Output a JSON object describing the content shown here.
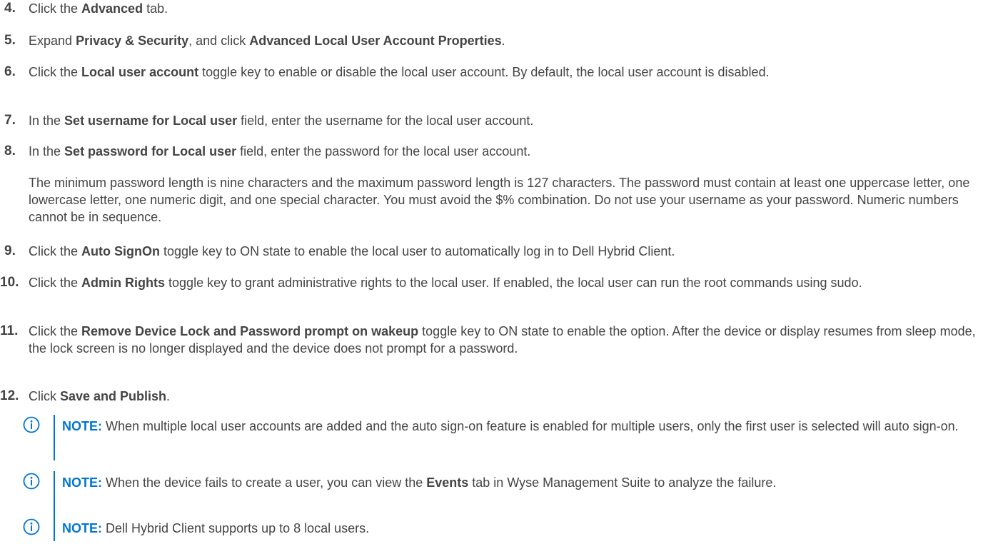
{
  "steps": [
    {
      "num": "4.",
      "parts": [
        {
          "t": "Click the "
        },
        {
          "b": "Advanced"
        },
        {
          "t": " tab."
        }
      ]
    },
    {
      "num": "5.",
      "parts": [
        {
          "t": "Expand "
        },
        {
          "b": "Privacy & Security"
        },
        {
          "t": ", and click "
        },
        {
          "b": "Advanced Local User Account Properties"
        },
        {
          "t": "."
        }
      ]
    },
    {
      "num": "6.",
      "parts": [
        {
          "t": "Click the "
        },
        {
          "b": "Local user account"
        },
        {
          "t": " toggle key to enable or disable the local user account. By default, the local user account is disabled."
        }
      ]
    },
    {
      "num": "7.",
      "parts": [
        {
          "t": "In the "
        },
        {
          "b": "Set username for Local user"
        },
        {
          "t": " field, enter the username for the local user account."
        }
      ]
    },
    {
      "num": "8.",
      "parts": [
        {
          "t": "In the "
        },
        {
          "b": "Set password for Local user"
        },
        {
          "t": " field, enter the password for the local user account."
        }
      ]
    },
    {
      "num": "9.",
      "parts": [
        {
          "t": "Click the "
        },
        {
          "b": "Auto SignOn"
        },
        {
          "t": " toggle key to ON state to enable the local user to automatically log in to Dell Hybrid Client."
        }
      ]
    },
    {
      "num": "10.",
      "parts": [
        {
          "t": "Click the "
        },
        {
          "b": "Admin Rights"
        },
        {
          "t": " toggle key to grant administrative rights to the local user. If enabled, the local user can run the root commands using sudo."
        }
      ]
    },
    {
      "num": "11.",
      "parts": [
        {
          "t": "Click the "
        },
        {
          "b": "Remove Device Lock and Password prompt on wakeup"
        },
        {
          "t": " toggle key to ON state to enable the option. After the device or display resumes from sleep mode, the lock screen is no longer displayed and the device does not prompt for a password."
        }
      ]
    },
    {
      "num": "12.",
      "parts": [
        {
          "t": "Click "
        },
        {
          "b": "Save and Publish"
        },
        {
          "t": "."
        }
      ]
    }
  ],
  "password_paragraph": "The minimum password length is nine characters and the maximum password length is 127 characters. The password must contain at least one uppercase letter, one lowercase letter, one numeric digit, and one special character. You must avoid the $% combination. Do not use your username as your password. Numeric numbers cannot be in sequence.",
  "notes": [
    {
      "label": "NOTE:",
      "parts": [
        {
          "t": " When multiple local user accounts are added and the auto sign-on feature is enabled for multiple users, only the first user is selected will auto sign-on."
        }
      ]
    },
    {
      "label": "NOTE:",
      "parts": [
        {
          "t": " When the device fails to create a user, you can view the "
        },
        {
          "b": "Events"
        },
        {
          "t": " tab in Wyse Management Suite to analyze the failure."
        }
      ]
    },
    {
      "label": "NOTE:",
      "parts": [
        {
          "t": " Dell Hybrid Client supports up to 8 local users."
        }
      ]
    }
  ],
  "colors": {
    "text": "#444444",
    "accent": "#0076ce"
  },
  "icons": {
    "note": "info-circle-icon"
  }
}
